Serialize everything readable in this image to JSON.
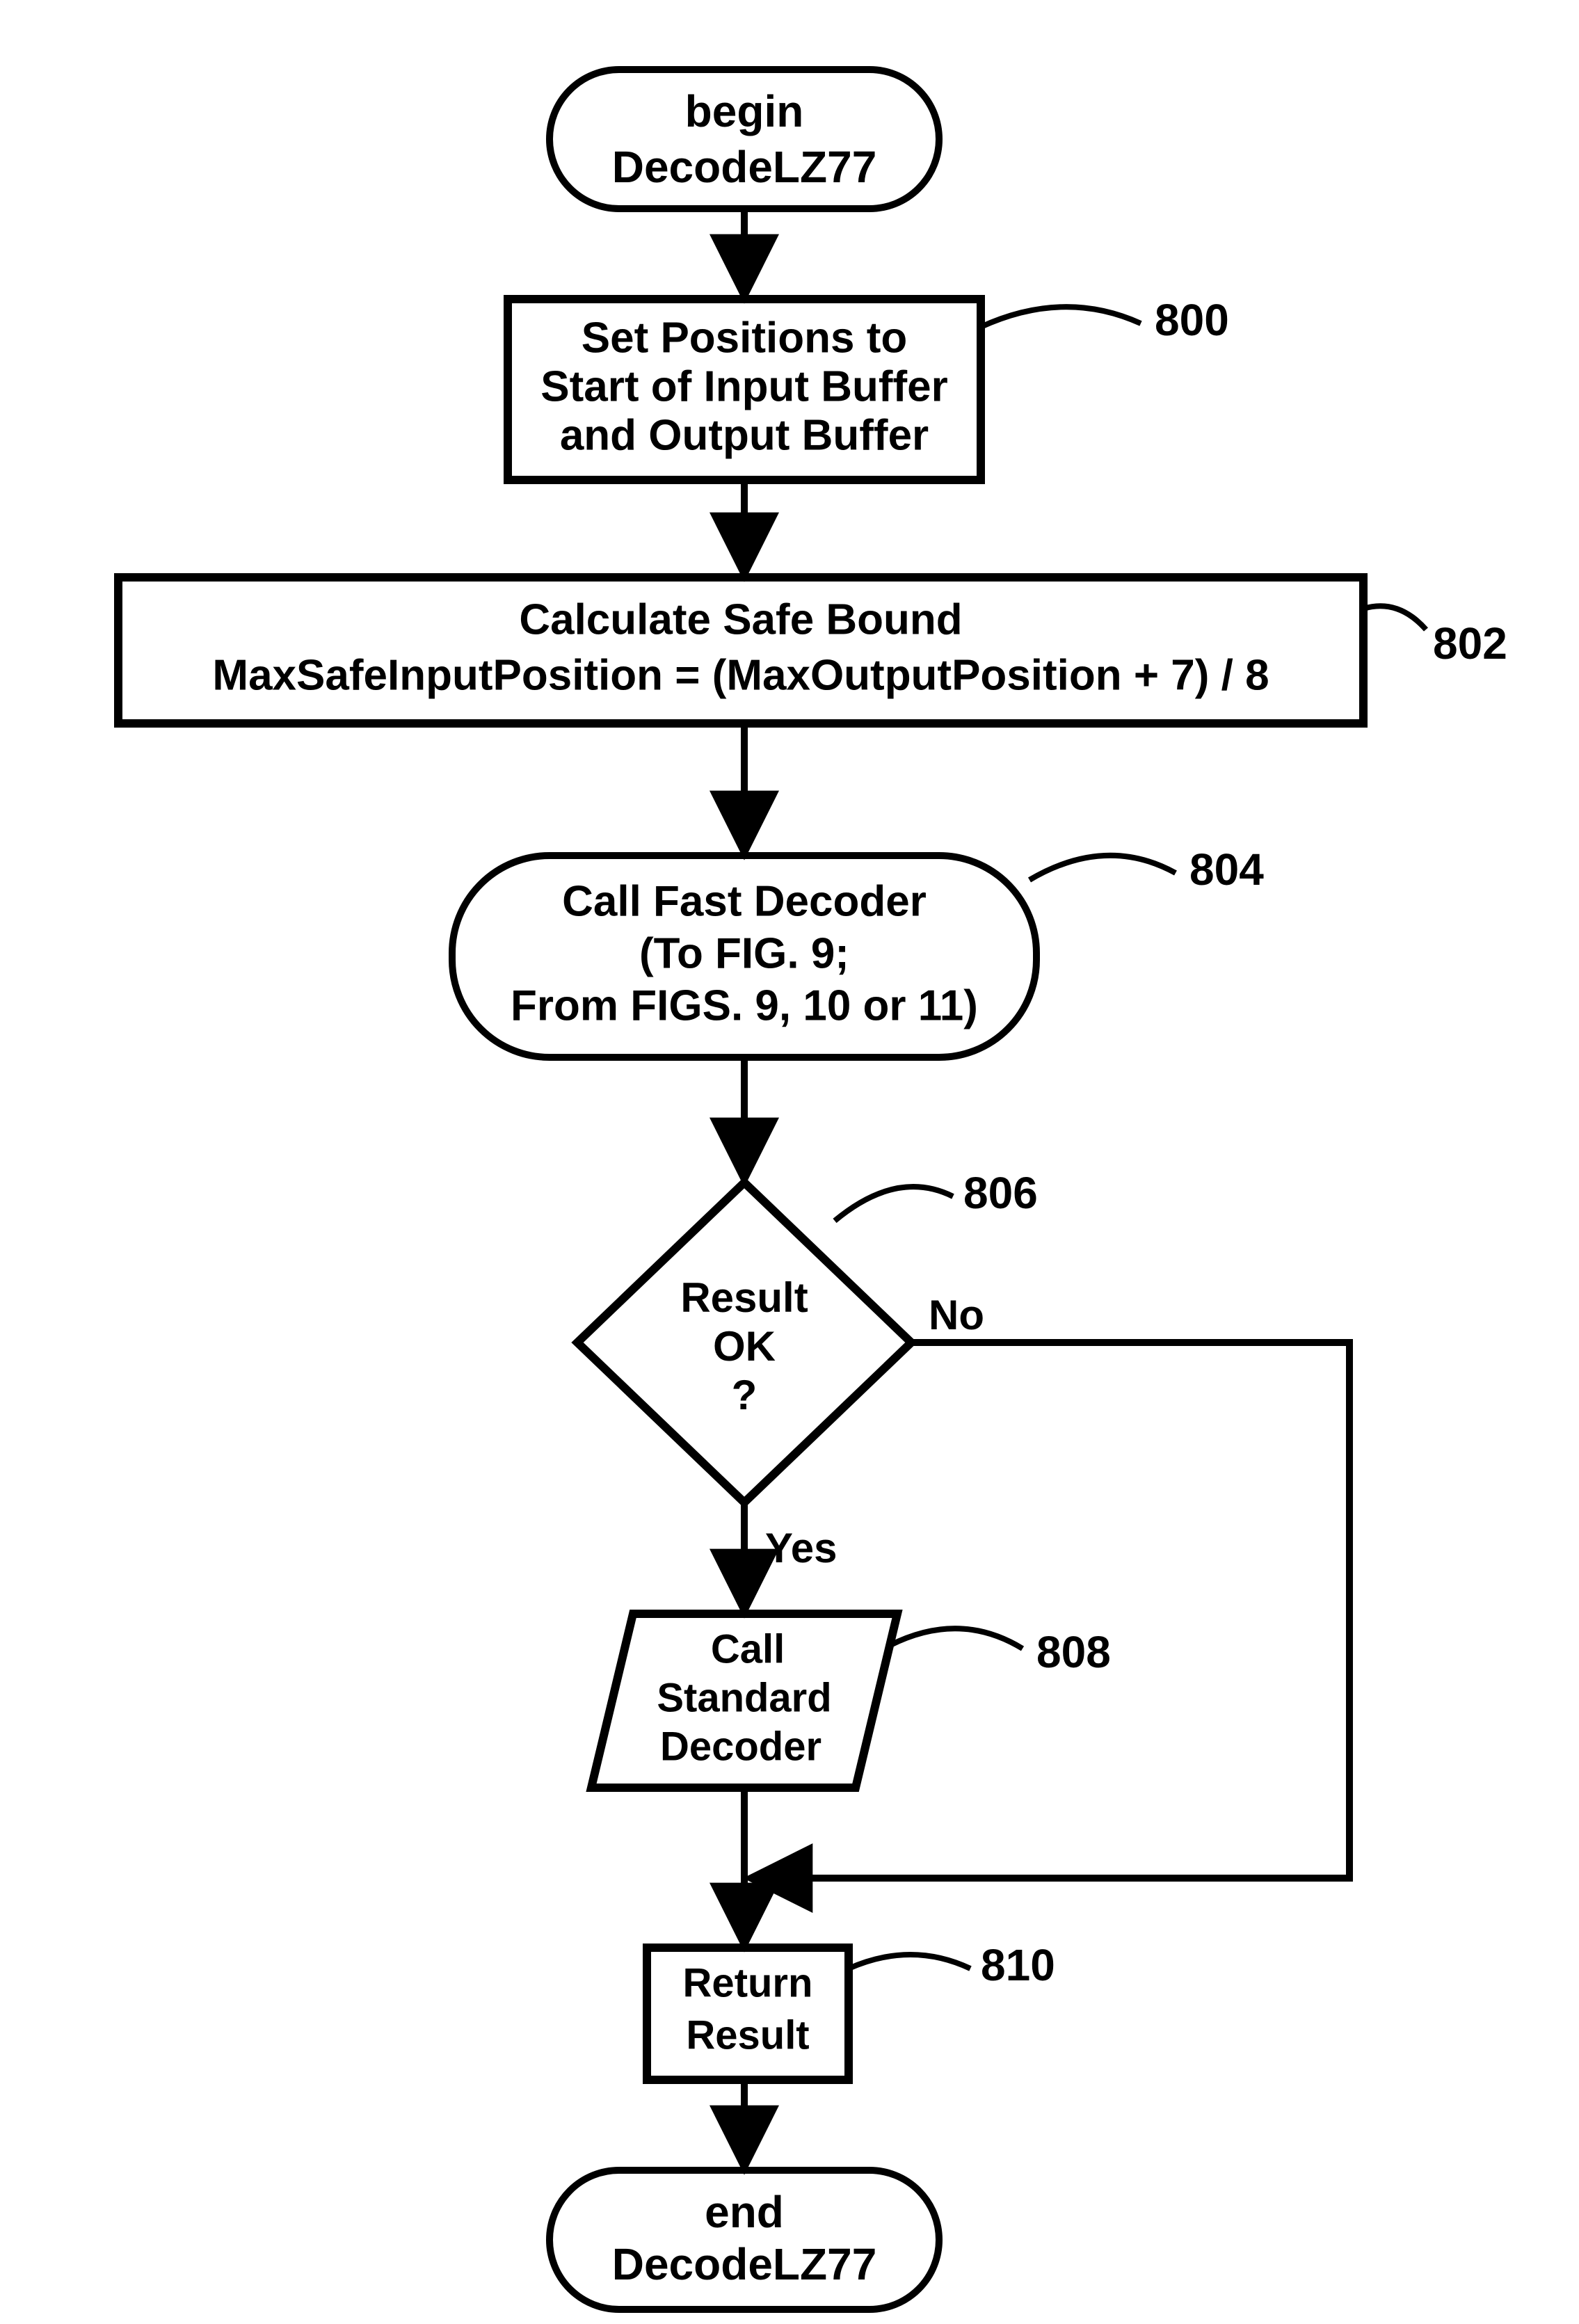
{
  "nodes": {
    "start": {
      "line1": "begin",
      "line2": "DecodeLZ77"
    },
    "set_positions": {
      "line1": "Set Positions to",
      "line2": "Start of Input Buffer",
      "line3": "and Output Buffer",
      "callout": "800"
    },
    "safe_bound": {
      "line1": "Calculate Safe Bound",
      "line2": "MaxSafeInputPosition = (MaxOutputPosition + 7) / 8",
      "callout": "802"
    },
    "fast_decoder": {
      "line1": "Call Fast Decoder",
      "line2": "(To FIG. 9;",
      "line3": "From FIGS. 9, 10 or 11)",
      "callout": "804"
    },
    "decision": {
      "line1": "Result",
      "line2": "OK",
      "line3": "?",
      "callout": "806"
    },
    "std_decoder": {
      "line1": "Call",
      "line2": "Standard",
      "line3": "Decoder",
      "callout": "808"
    },
    "return_result": {
      "line1": "Return",
      "line2": "Result",
      "callout": "810"
    },
    "end": {
      "line1": "end",
      "line2": "DecodeLZ77"
    }
  },
  "edges": {
    "decision_yes": "Yes",
    "decision_no": "No"
  }
}
